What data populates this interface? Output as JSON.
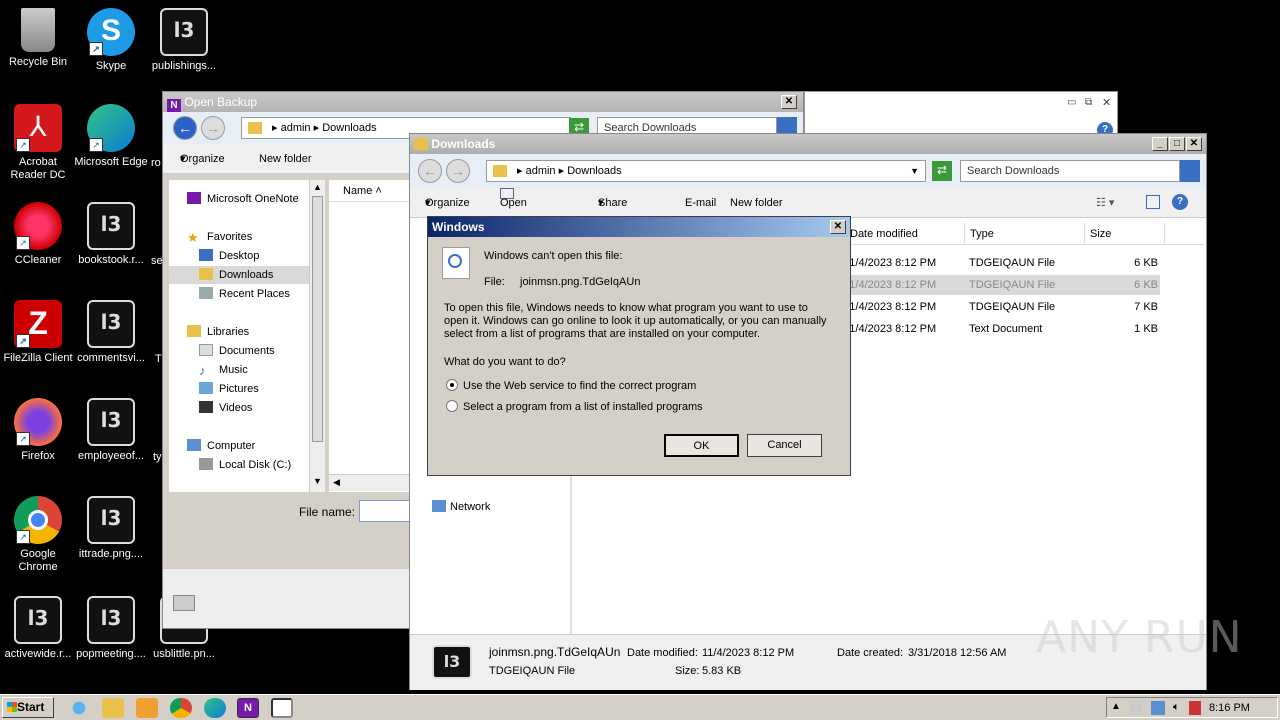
{
  "desktop": {
    "icons": [
      {
        "label": "Recycle Bin",
        "icon": "recycle-bin-icon"
      },
      {
        "label": "Skype",
        "icon": "skype-icon"
      },
      {
        "label": "publishings...",
        "icon": "file-icon"
      },
      {
        "label": "Acrobat Reader DC",
        "icon": "acrobat-icon"
      },
      {
        "label": "Microsoft Edge",
        "icon": "edge-icon"
      },
      {
        "label": "CCleaner",
        "icon": "ccleaner-icon"
      },
      {
        "label": "bookstook.r...",
        "icon": "file-icon"
      },
      {
        "label": "FileZilla Client",
        "icon": "filezilla-icon"
      },
      {
        "label": "commentsvi...",
        "icon": "file-icon"
      },
      {
        "label": "Firefox",
        "icon": "firefox-icon"
      },
      {
        "label": "employeeof...",
        "icon": "file-icon"
      },
      {
        "label": "Google Chrome",
        "icon": "chrome-icon"
      },
      {
        "label": "ittrade.png....",
        "icon": "file-icon"
      },
      {
        "label": "activewide.r...",
        "icon": "file-icon"
      },
      {
        "label": "popmeeting....",
        "icon": "file-icon"
      },
      {
        "label": "usblittle.pn...",
        "icon": "file-icon"
      }
    ],
    "partial_labels": [
      "ro",
      "se",
      "T",
      "ty"
    ]
  },
  "open_backup": {
    "title": "Open Backup",
    "breadcrumb": [
      "admin",
      "Downloads"
    ],
    "search_placeholder": "Search Downloads",
    "organize": "Organize",
    "new_folder": "New folder",
    "nav": {
      "onenote": "Microsoft OneNote",
      "favorites": "Favorites",
      "desktop": "Desktop",
      "downloads": "Downloads",
      "recent": "Recent Places",
      "libraries": "Libraries",
      "documents": "Documents",
      "music": "Music",
      "pictures": "Pictures",
      "videos": "Videos",
      "computer": "Computer",
      "local_disk": "Local Disk (C:)"
    },
    "col_name": "Name",
    "file_name_label": "File name:"
  },
  "downloads": {
    "title": "Downloads",
    "breadcrumb": [
      "admin",
      "Downloads"
    ],
    "search_placeholder": "Search Downloads",
    "toolbar": {
      "organize": "Organize",
      "open_with": "Open with...",
      "share_with": "Share with",
      "email": "E-mail",
      "new_folder": "New folder"
    },
    "columns": {
      "date": "Date modified",
      "type": "Type",
      "size": "Size"
    },
    "rows": [
      {
        "date": "11/4/2023 8:12 PM",
        "type": "TDGEIQAUN File",
        "size": "6 KB"
      },
      {
        "date": "11/4/2023 8:12 PM",
        "type": "TDGEIQAUN File",
        "size": "6 KB"
      },
      {
        "date": "11/4/2023 8:12 PM",
        "type": "TDGEIQAUN File",
        "size": "7 KB"
      },
      {
        "date": "11/4/2023 8:12 PM",
        "type": "Text Document",
        "size": "1 KB"
      }
    ],
    "network": "Network",
    "details": {
      "filename": "joinmsn.png.TdGeIqAUn",
      "date_modified_label": "Date modified:",
      "date_modified": "11/4/2023 8:12 PM",
      "date_created_label": "Date created:",
      "date_created": "3/31/2018 12:56 AM",
      "filetype": "TDGEIQAUN File",
      "size_label": "Size:",
      "size": "5.83 KB"
    }
  },
  "dialog": {
    "title": "Windows",
    "heading": "Windows can't open this file:",
    "file_label": "File:",
    "file_name": "joinmsn.png.TdGeIqAUn",
    "description": "To open this file, Windows needs to know what program you want to use to open it. Windows can go online to look it up automatically, or you can manually select from a list of programs that are installed on your computer.",
    "question": "What do you want to do?",
    "option1": "Use the Web service to find the correct program",
    "option2": "Select a program from a list of installed programs",
    "ok": "OK",
    "cancel": "Cancel"
  },
  "taskbar": {
    "start": "Start",
    "clock": "8:16 PM"
  },
  "watermark": "ANY RUN"
}
